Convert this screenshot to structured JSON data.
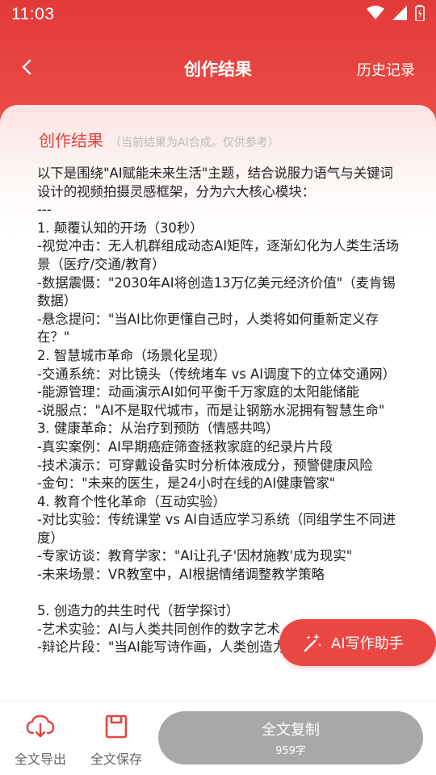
{
  "status": {
    "time": "11:03"
  },
  "header": {
    "title": "创作结果",
    "history": "历史记录"
  },
  "card": {
    "title": "创作结果",
    "subtitle": "（当前结果为AI合成。仅供参考）",
    "lines": [
      "以下是围绕\"AI赋能未来生活\"主题，结合说服力语气与关键词设计的视频拍摄灵感框架，分为六大核心模块：",
      "---",
      "1. 颠覆认知的开场（30秒）",
      "-视觉冲击：无人机群组成动态AI矩阵，逐渐幻化为人类生活场景（医疗/交通/教育）",
      "-数据震慑：\"2030年AI将创造13万亿美元经济价值\"（麦肯锡数据）",
      "-悬念提问：\"当AI比你更懂自己时，人类将如何重新定义存在？\"",
      "2. 智慧城市革命（场景化呈现）",
      "-交通系统：对比镜头（传统堵车 vs AI调度下的立体交通网）",
      "-能源管理：动画演示AI如何平衡千万家庭的太阳能储能",
      "-说服点：\"AI不是取代城市，而是让钢筋水泥拥有智慧生命\"",
      "3. 健康革命：从治疗到预防（情感共鸣）",
      "-真实案例：AI早期癌症筛查拯救家庭的纪录片片段",
      "-技术演示：可穿戴设备实时分析体液成分，预警健康风险",
      "-金句：\"未来的医生，是24小时在线的AI健康管家\"",
      "4. 教育个性化革命（互动实验）",
      "-对比实验：传统课堂 vs AI自适应学习系统（同组学生不同进度）",
      "-专家访谈：教育学家：\"AI让孔子'因材施教'成为现实\"",
      "-未来场景：VR教室中，AI根据情绪调整教学策略",
      "",
      "5. 创造力的共生时代（哲学探讨）",
      "-艺术实验：AI与人类共同创作的数字艺术",
      "-辩论片段：\"当AI能写诗作画，人类创造力何去何从？\""
    ]
  },
  "ai_helper": {
    "label": "AI写作助手"
  },
  "bottom": {
    "export_label": "全文导出",
    "save_label": "全文保存",
    "copy_label": "全文复制",
    "char_count": "959字"
  },
  "colors": {
    "accent": "#e5433f",
    "button_gray": "#a8a8a8"
  }
}
